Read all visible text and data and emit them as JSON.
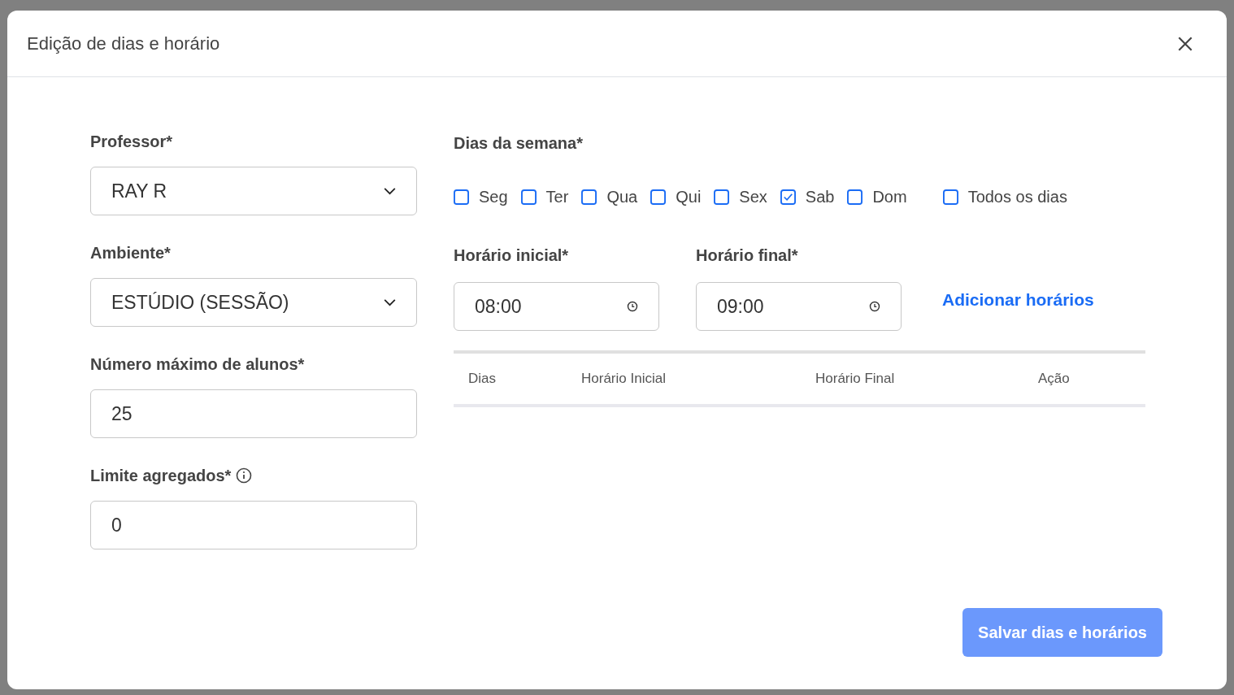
{
  "dialog": {
    "title": "Edição de dias e horário"
  },
  "left_fields": [
    {
      "kind": "select",
      "label": "Professor*",
      "value": "RAY R",
      "info": false
    },
    {
      "kind": "select",
      "label": "Ambiente*",
      "value": "ESTÚDIO (SESSÃO)",
      "info": false
    },
    {
      "kind": "text",
      "label": "Número máximo de alunos*",
      "value": "25",
      "info": false
    },
    {
      "kind": "text",
      "label": "Limite agregados*",
      "value": "0",
      "info": true
    }
  ],
  "weekdays": {
    "label": "Dias da semana*",
    "days": [
      {
        "label": "Seg",
        "checked": false
      },
      {
        "label": "Ter",
        "checked": false
      },
      {
        "label": "Qua",
        "checked": false
      },
      {
        "label": "Qui",
        "checked": false
      },
      {
        "label": "Sex",
        "checked": false
      },
      {
        "label": "Sab",
        "checked": true
      },
      {
        "label": "Dom",
        "checked": false
      }
    ],
    "all_days": {
      "label": "Todos os dias",
      "checked": false
    }
  },
  "times": [
    {
      "label": "Horário inicial*",
      "value": "08:00"
    },
    {
      "label": "Horário final*",
      "value": "09:00"
    }
  ],
  "add_link": "Adicionar horários",
  "table": {
    "columns": [
      "Dias",
      "Horário Inicial",
      "Horário Final",
      "Ação"
    ]
  },
  "save_button": {
    "label": "Salvar dias e horários",
    "disabled": true
  }
}
